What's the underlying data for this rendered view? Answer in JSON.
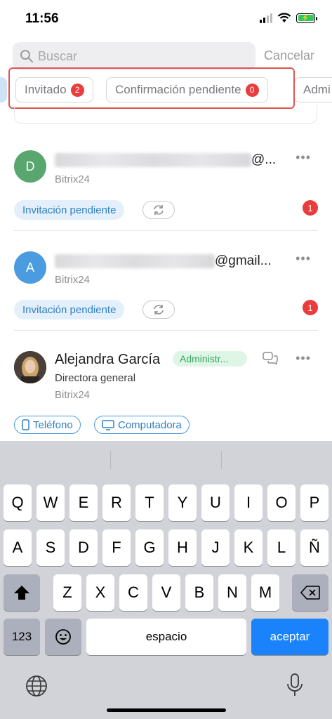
{
  "status_bar": {
    "time": "11:56"
  },
  "search": {
    "placeholder": "Buscar",
    "cancel_label": "Cancelar"
  },
  "filters": [
    {
      "label": "Invitado",
      "count": "2"
    },
    {
      "label": "Confirmación pendiente",
      "count": "0"
    },
    {
      "label": "Admi"
    }
  ],
  "users": [
    {
      "avatar_letter": "D",
      "avatar_color": "#5aa66f",
      "email_tail": "@...",
      "company": "Bitrix24",
      "status": "Invitación pendiente",
      "notifications": "1"
    },
    {
      "avatar_letter": "A",
      "avatar_color": "#4a9be0",
      "email_tail": "@gmail...",
      "company": "Bitrix24",
      "status": "Invitación pendiente",
      "notifications": "1"
    },
    {
      "name": "Alejandra García",
      "role": "Administr...",
      "position": "Directora general",
      "company": "Bitrix24",
      "devices": [
        "Teléfono",
        "Computadora"
      ]
    }
  ],
  "keyboard": {
    "row1": [
      "Q",
      "W",
      "E",
      "R",
      "T",
      "Y",
      "U",
      "I",
      "O",
      "P"
    ],
    "row2": [
      "A",
      "S",
      "D",
      "F",
      "G",
      "H",
      "J",
      "K",
      "L",
      "Ñ"
    ],
    "row3": [
      "Z",
      "X",
      "C",
      "V",
      "B",
      "N",
      "M"
    ],
    "numbers_label": "123",
    "space_label": "espacio",
    "return_label": "aceptar"
  },
  "colors": {
    "accent": "#1a82fb",
    "badge_red": "#ea3c3c",
    "highlight": "#e05353"
  }
}
